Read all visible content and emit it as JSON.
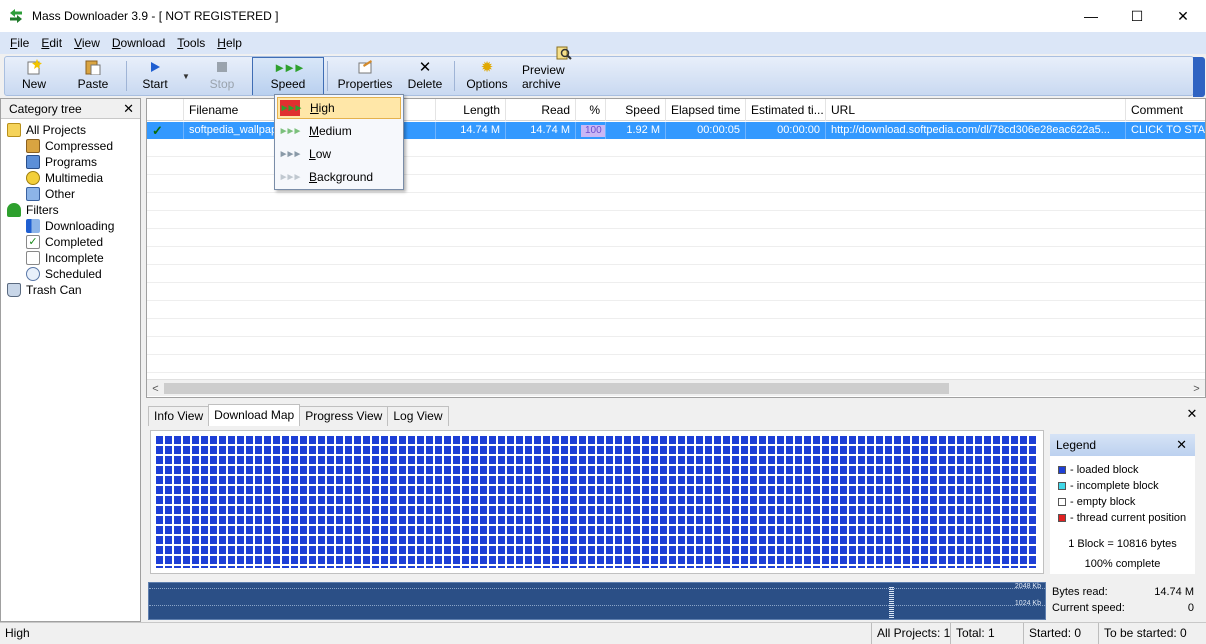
{
  "window": {
    "title": "Mass Downloader 3.9  - [ NOT REGISTERED ]",
    "controls": [
      "—",
      "☐",
      "✕"
    ]
  },
  "menu": [
    "File",
    "Edit",
    "View",
    "Download",
    "Tools",
    "Help"
  ],
  "toolbar": {
    "new": "New",
    "paste": "Paste",
    "start": "Start",
    "stop": "Stop",
    "speed": "Speed",
    "properties": "Properties",
    "delete": "Delete",
    "options": "Options",
    "preview": "Preview archive"
  },
  "speed_menu": {
    "items": [
      "High",
      "Medium",
      "Low",
      "Background"
    ],
    "selected": "High"
  },
  "category_tree": {
    "title": "Category tree",
    "items": [
      {
        "label": "All Projects"
      },
      {
        "label": "Compressed"
      },
      {
        "label": "Programs"
      },
      {
        "label": "Multimedia"
      },
      {
        "label": "Other"
      },
      {
        "label": "Filters"
      },
      {
        "label": "Downloading"
      },
      {
        "label": "Completed"
      },
      {
        "label": "Incomplete"
      },
      {
        "label": "Scheduled"
      },
      {
        "label": "Trash Can"
      }
    ]
  },
  "download_list": {
    "columns": [
      "Filename",
      "Length",
      "Read",
      "%",
      "Speed",
      "Elapsed time",
      "Estimated ti...",
      "URL",
      "Comment"
    ],
    "row": {
      "filename": "softpedia_wallpap",
      "length": "14.74 M",
      "read": "14.74 M",
      "percent": "100",
      "speed": "1.92 M",
      "elapsed": "00:00:05",
      "estimated": "00:00:00",
      "url": "http://download.softpedia.com/dl/78cd306e28eac622a5...",
      "comment": "CLICK TO STAR"
    }
  },
  "bottom_tabs": [
    "Info View",
    "Download Map",
    "Progress View",
    "Log View"
  ],
  "active_tab": "Download Map",
  "legend": {
    "title": "Legend",
    "items": [
      {
        "label": "- loaded block",
        "color": "#1e3fd6"
      },
      {
        "label": "- incomplete block",
        "color": "#40d8e8"
      },
      {
        "label": "- empty block",
        "color": "#ffffff"
      },
      {
        "label": "- thread current position",
        "color": "#e02020"
      }
    ],
    "block_size": "1 Block = 10816 bytes",
    "complete": "100% complete"
  },
  "graph": {
    "label_top": "2048 Kb",
    "label_mid": "1024 Kb"
  },
  "stats": {
    "bytes_read_label": "Bytes read:",
    "bytes_read": "14.74 M",
    "speed_label": "Current speed:",
    "speed": "0"
  },
  "statusbar": {
    "mode": "High",
    "all_projects": "All Projects: 1",
    "total": "Total: 1",
    "started": "Started: 0",
    "to_be_started": "To be started: 0"
  }
}
